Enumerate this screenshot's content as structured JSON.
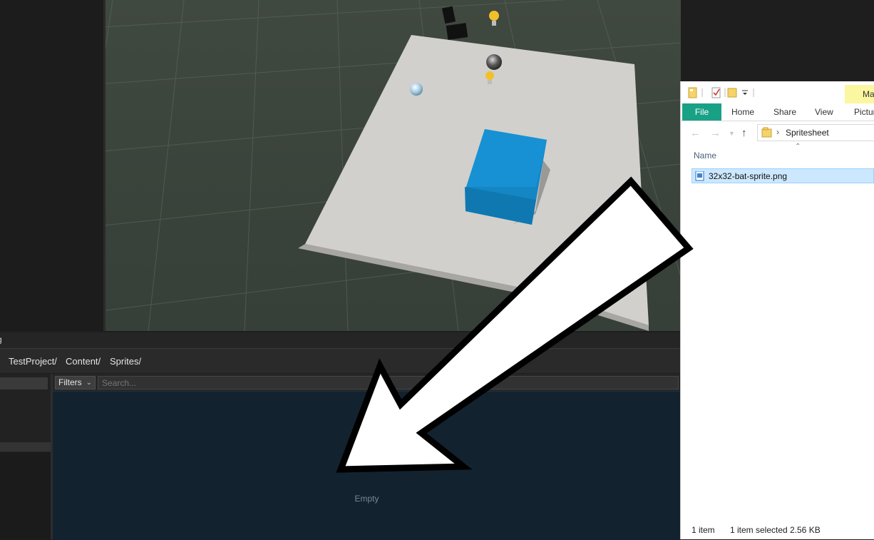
{
  "editor": {
    "panel_title": "g",
    "breadcrumb": [
      "TestProject/",
      "Content/",
      "Sprites/"
    ],
    "filters_label": "Filters",
    "search_placeholder": "Search...",
    "empty_label": "Empty"
  },
  "explorer": {
    "context_tab": "Ma",
    "tabs": {
      "file": "File",
      "home": "Home",
      "share": "Share",
      "view": "View",
      "picture": "Pictur"
    },
    "address": "Spritesheet",
    "column_name": "Name",
    "file": "32x32-bat-sprite.png",
    "status_items": "1 item",
    "status_selected": "1 item selected",
    "status_size": "2.56 KB"
  },
  "colors": {
    "editor_bg": "#1e1e1e",
    "content_bg": "#13222f",
    "cube": "#1586c4",
    "file_tab": "#19a186",
    "selection": "#cce8ff"
  }
}
